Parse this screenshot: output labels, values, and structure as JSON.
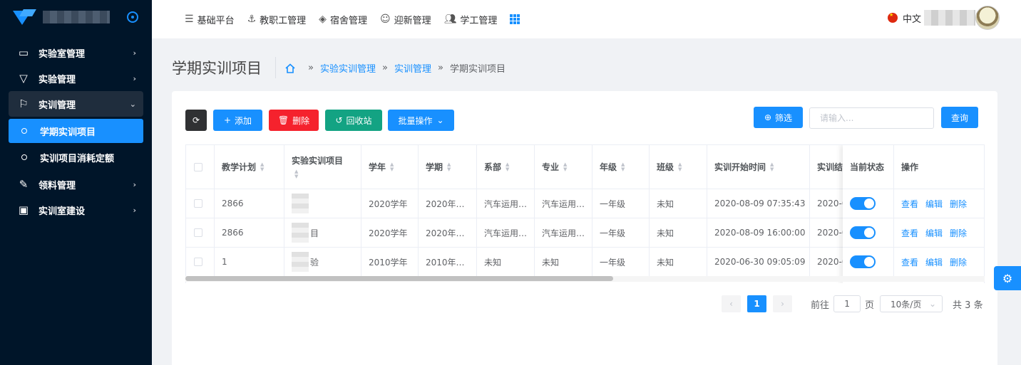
{
  "sidebar": {
    "menu": [
      {
        "label": "实验室管理",
        "icon": "monitor-icon"
      },
      {
        "label": "实验管理",
        "icon": "filter-icon"
      },
      {
        "label": "实训管理",
        "icon": "flag-icon"
      }
    ],
    "sub_items": [
      {
        "label": "学期实训项目",
        "active": true
      },
      {
        "label": "实训项目消耗定额",
        "active": false
      }
    ],
    "menu_after": [
      {
        "label": "领料管理",
        "icon": "feather-icon"
      },
      {
        "label": "实训室建设",
        "icon": "board-icon"
      }
    ]
  },
  "topnav": {
    "items": [
      {
        "label": "基础平台",
        "icon": "database-icon"
      },
      {
        "label": "教职工管理",
        "icon": "anchor-icon"
      },
      {
        "label": "宿舍管理",
        "icon": "layers-icon"
      },
      {
        "label": "迎新管理",
        "icon": "smile-icon"
      },
      {
        "label": "学工管理",
        "icon": "users-icon"
      }
    ],
    "lang": "中文"
  },
  "page": {
    "title": "学期实训项目",
    "breadcrumb": [
      "实验实训管理",
      "实训管理",
      "学期实训项目"
    ],
    "bc_sep": "»"
  },
  "toolbar": {
    "add": "添加",
    "delete": "删除",
    "recycle": "回收站",
    "batch": "批量操作",
    "filter": "筛选",
    "search_placeholder": "请输入...",
    "query": "查询"
  },
  "table": {
    "headers": [
      "教学计划",
      "实验实训项目",
      "学年",
      "学期",
      "系部",
      "专业",
      "年级",
      "班级",
      "实训开始时间",
      "实训结"
    ],
    "fixed_headers": [
      "当前状态",
      "操作"
    ],
    "rows": [
      [
        "2866",
        "",
        "2020学年",
        "2020年…",
        "汽车运用…",
        "汽车运用…",
        "一年级",
        "未知",
        "2020-08-09 07:35:43",
        "2020-0"
      ],
      [
        "2866",
        "",
        "2020学年",
        "2020年…",
        "汽车运用…",
        "汽车运用…",
        "一年级",
        "未知",
        "2020-08-09 16:00:00",
        "2020-0"
      ],
      [
        "1",
        "",
        "2010学年",
        "2010年…",
        "未知",
        "未知",
        "一年级",
        "未知",
        "2020-06-30 09:05:09",
        "2020-0"
      ]
    ],
    "row_suffix": [
      "",
      "目",
      "验"
    ],
    "status_on": [
      true,
      true,
      true
    ],
    "ops": [
      "查看",
      "编辑",
      "删除"
    ]
  },
  "pagination": {
    "current": "1",
    "goto_label": "前往",
    "goto_value": "1",
    "page_unit": "页",
    "page_size": "10条/页",
    "total": "共 3 条"
  },
  "colors": {
    "accent": "#1890ff",
    "danger": "#f5222d",
    "success": "#13a383",
    "sidebar": "#001529"
  }
}
